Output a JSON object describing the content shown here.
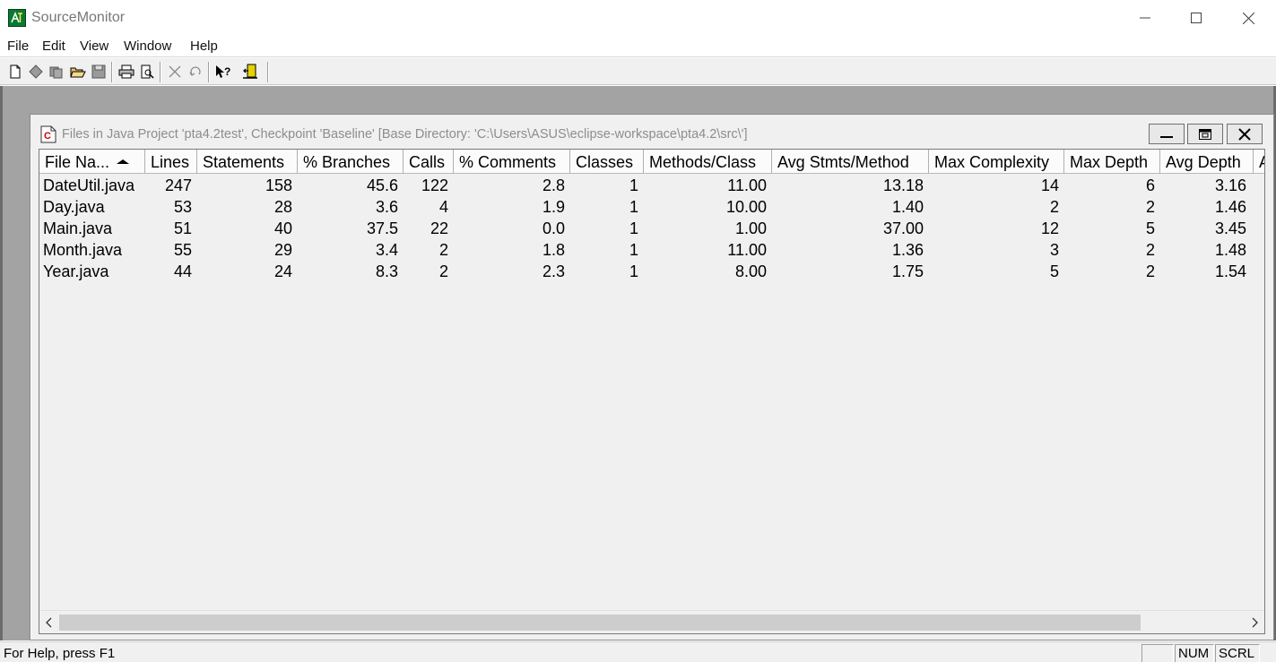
{
  "app": {
    "title": "SourceMonitor"
  },
  "menu": [
    {
      "label": "File"
    },
    {
      "label": "Edit"
    },
    {
      "label": "View"
    },
    {
      "label": "Window"
    },
    {
      "label": "Help"
    }
  ],
  "toolbar_icons": [
    "new-file-icon",
    "new-checkpoint-icon",
    "copy-checkpoint-icon",
    "open-folder-icon",
    "save-icon",
    "print-icon",
    "print-preview-icon",
    "delete-icon",
    "undo-icon",
    "context-help-icon",
    "exit-icon"
  ],
  "child": {
    "title": "Files in Java Project 'pta4.2test', Checkpoint 'Baseline'  [Base Directory: 'C:\\Users\\ASUS\\eclipse-workspace\\pta4.2\\src\\']"
  },
  "table": {
    "columns": [
      "File Na...",
      "Lines",
      "Statements",
      "% Branches",
      "Calls",
      "% Comments",
      "Classes",
      "Methods/Class",
      "Avg Stmts/Method",
      "Max Complexity",
      "Max Depth",
      "Avg Depth",
      "A"
    ],
    "sort_column": "File Na...",
    "sort_direction": "ascending",
    "rows": [
      [
        "DateUtil.java",
        "247",
        "158",
        "45.6",
        "122",
        "2.8",
        "1",
        "11.00",
        "13.18",
        "14",
        "6",
        "3.16"
      ],
      [
        "Day.java",
        "53",
        "28",
        "3.6",
        "4",
        "1.9",
        "1",
        "10.00",
        "1.40",
        "2",
        "2",
        "1.46"
      ],
      [
        "Main.java",
        "51",
        "40",
        "37.5",
        "22",
        "0.0",
        "1",
        "1.00",
        "37.00",
        "12",
        "5",
        "3.45"
      ],
      [
        "Month.java",
        "55",
        "29",
        "3.4",
        "2",
        "1.8",
        "1",
        "11.00",
        "1.36",
        "3",
        "2",
        "1.48"
      ],
      [
        "Year.java",
        "44",
        "24",
        "8.3",
        "2",
        "2.3",
        "1",
        "8.00",
        "1.75",
        "5",
        "2",
        "1.54"
      ]
    ]
  },
  "status": {
    "help_text": "For Help, press F1",
    "num": "NUM",
    "scrl": "SCRL"
  }
}
